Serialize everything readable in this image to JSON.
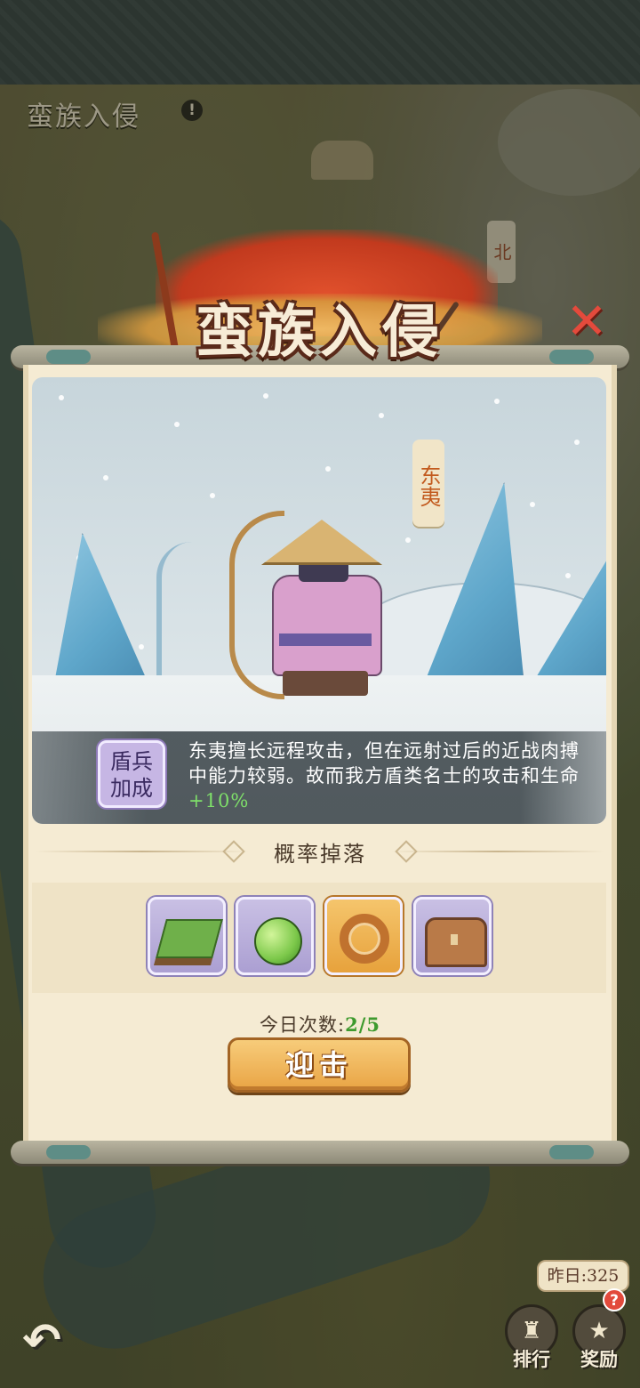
{
  "map": {
    "event_title": "蛮族入侵",
    "info_icon": "!",
    "north_label": "北"
  },
  "modal": {
    "title": "蛮族入侵",
    "close_icon": "✕",
    "enemy_name": "东夷",
    "bonus_badge": "盾兵加成",
    "description_main": "东夷擅长远程攻击，但在远射过后的近战肉搏中能力较弱。故而我方盾类名士的攻击和生命",
    "description_bonus": "+10%",
    "drop_title": "概率掉落",
    "drops": [
      {
        "name": "grass-tile",
        "rarity": "purple"
      },
      {
        "name": "green-fruit",
        "rarity": "purple"
      },
      {
        "name": "rope",
        "rarity": "gold"
      },
      {
        "name": "treasure-chest",
        "rarity": "purple"
      }
    ],
    "attempts_label": "今日次数:",
    "attempts_value": "2/5",
    "attempts_used": 2,
    "attempts_max": 5,
    "fight_button": "迎击"
  },
  "hud": {
    "yesterday": "昨日:325",
    "alert_badge": "?",
    "rank_label": "排行",
    "reward_label": "奖励",
    "back_icon": "↶"
  },
  "colors": {
    "bonus_green": "#7fe06a",
    "attempts_green": "#3e9a2e",
    "close_red": "#e44a3c",
    "button_orange": "#e9a444"
  }
}
